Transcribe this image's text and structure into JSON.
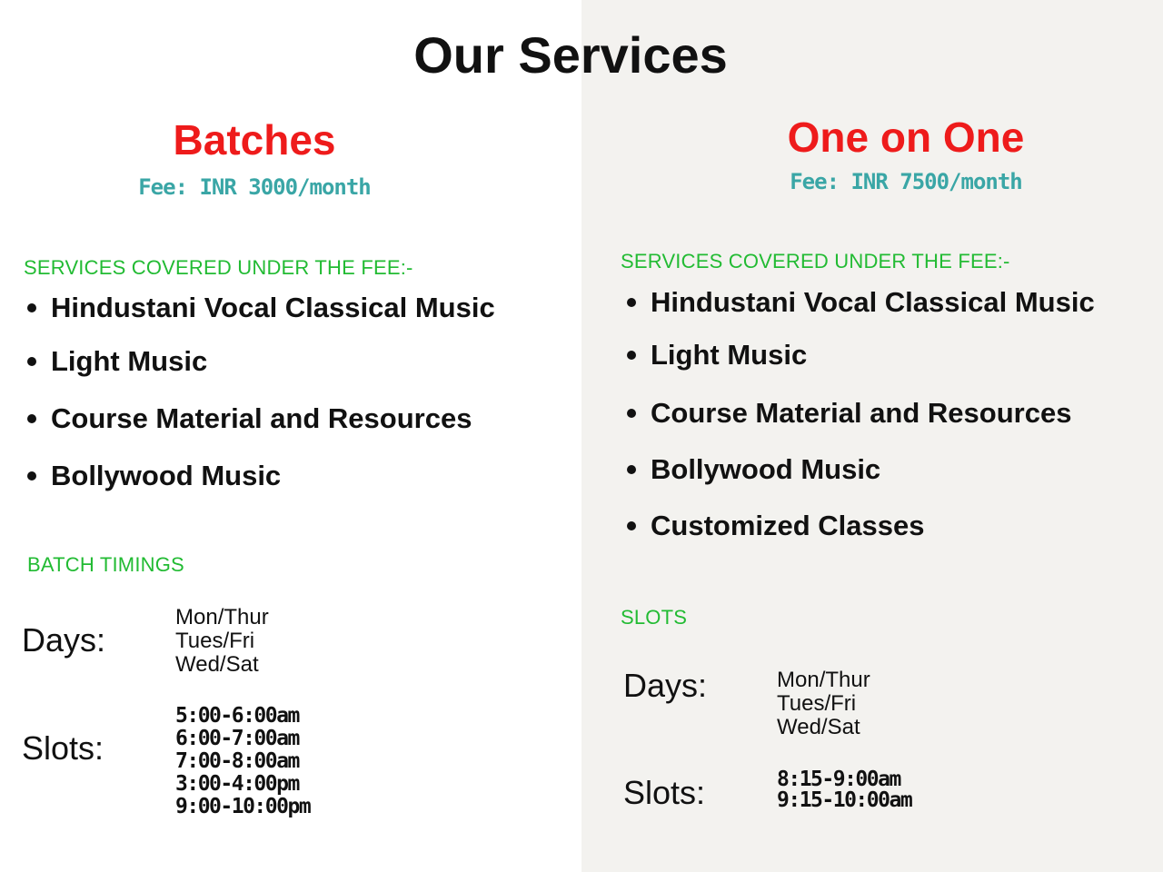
{
  "page": {
    "title": "Our Services"
  },
  "batches": {
    "title": "Batches",
    "fee": "Fee: INR 3000/month",
    "services_label": "SERVICES COVERED UNDER THE FEE:-",
    "services": [
      "Hindustani Vocal Classical Music",
      "Light Music",
      "Course Material and Resources",
      "Bollywood Music"
    ],
    "timings_label": "BATCH TIMINGS",
    "days_label": "Days:",
    "days": [
      "Mon/Thur",
      "Tues/Fri",
      "Wed/Sat"
    ],
    "slots_label": "Slots:",
    "slots": [
      "5:00-6:00am",
      "6:00-7:00am",
      "7:00-8:00am",
      "3:00-4:00pm",
      "9:00-10:00pm"
    ]
  },
  "one_on_one": {
    "title": "One on One",
    "fee": "Fee: INR 7500/month",
    "services_label": "SERVICES COVERED UNDER THE FEE:-",
    "services": [
      "Hindustani Vocal Classical Music",
      "Light Music",
      "Course Material and Resources",
      "Bollywood Music",
      "Customized Classes"
    ],
    "timings_label": "SLOTS",
    "days_label": "Days:",
    "days": [
      "Mon/Thur",
      "Tues/Fri",
      "Wed/Sat"
    ],
    "slots_label": "Slots:",
    "slots": [
      "8:15-9:00am",
      "9:15-10:00am"
    ]
  },
  "colors": {
    "title_red": "#ee1b1b",
    "fee_teal": "#3aa6a6",
    "label_green": "#22bb33",
    "right_panel_bg": "#f3f2ef"
  }
}
